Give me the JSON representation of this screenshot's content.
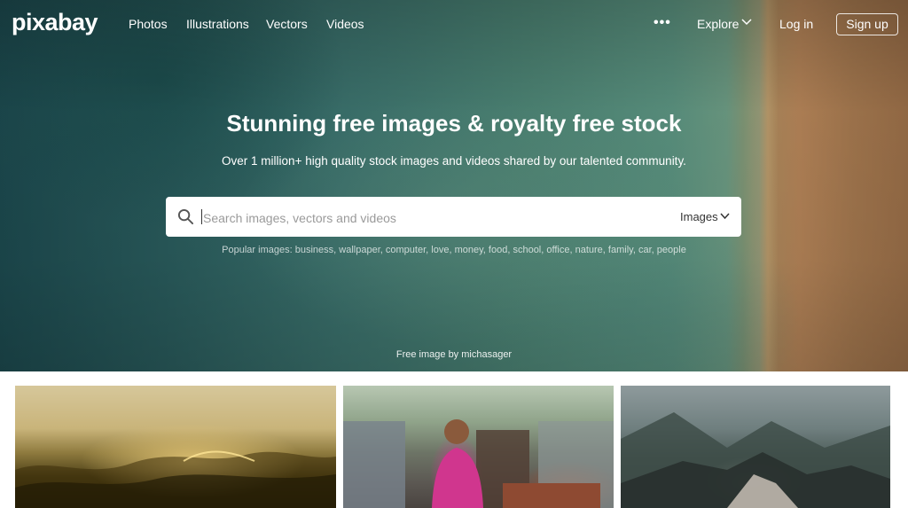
{
  "nav": {
    "logo": "pixabay",
    "links": [
      "Photos",
      "Illustrations",
      "Vectors",
      "Videos"
    ],
    "more_icon": "ellipsis-icon",
    "explore_label": "Explore",
    "login_label": "Log in",
    "signup_label": "Sign up"
  },
  "hero": {
    "title": "Stunning free images & royalty free stock",
    "subtitle": "Over 1 million+ high quality stock images and videos shared by our talented community.",
    "search": {
      "placeholder": "Search images, vectors and videos",
      "type_label": "Images",
      "icon": "search-icon"
    },
    "popular_label": "Popular images:",
    "popular_terms": [
      "business",
      "wallpaper",
      "computer",
      "love",
      "money",
      "food",
      "school",
      "office",
      "nature",
      "family",
      "car",
      "people"
    ],
    "credit": "Free image by michasager"
  },
  "colors": {
    "nav_text": "#ffffff",
    "search_bg": "#ffffff",
    "page_bg": "#ffffff"
  },
  "gallery": [
    {
      "subject": "golden sea waves at sunset"
    },
    {
      "subject": "smiling woman in pink sari"
    },
    {
      "subject": "misty rocky mountains"
    }
  ]
}
